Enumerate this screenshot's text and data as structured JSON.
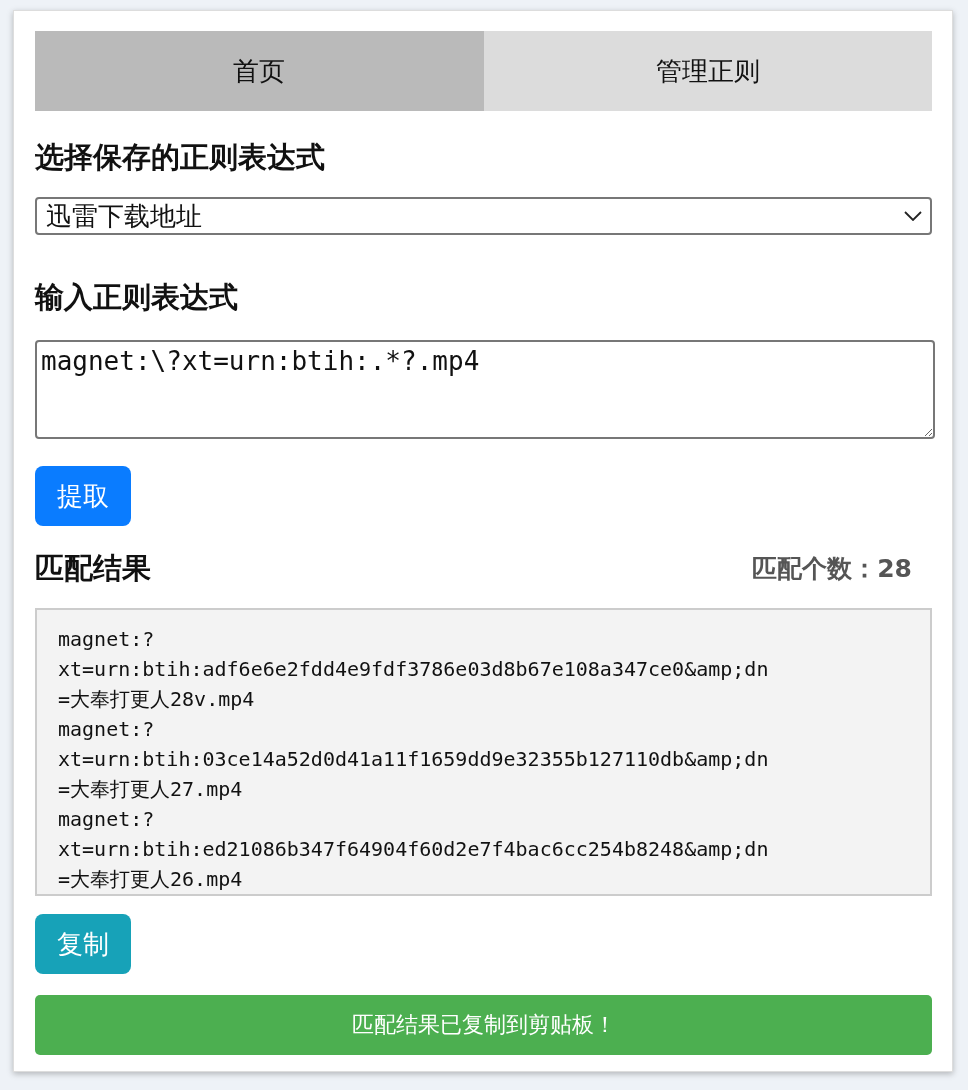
{
  "tabs": [
    {
      "label": "首页",
      "selected": true
    },
    {
      "label": "管理正则",
      "selected": false
    }
  ],
  "select_section": {
    "heading": "选择保存的正则表达式",
    "value": "迅雷下载地址"
  },
  "regex_section": {
    "heading": "输入正则表达式",
    "value": "magnet:\\?xt=urn:btih:.*?.mp4"
  },
  "extract_button": "提取",
  "results": {
    "heading": "匹配结果",
    "count": "匹配个数：28",
    "lines": [
      "magnet:?",
      "xt=urn:btih:adf6e6e2fdd4e9fdf3786e03d8b67e108a347ce0&amp;dn",
      "=大奉打更人28v.mp4",
      "magnet:?",
      "xt=urn:btih:03ce14a52d0d41a11f1659dd9e32355b127110db&amp;dn",
      "=大奉打更人27.mp4",
      "magnet:?",
      "xt=urn:btih:ed21086b347f64904f60d2e7f4bac6cc254b8248&amp;dn",
      "=大奉打更人26.mp4"
    ]
  },
  "copy_button": "复制",
  "notification": "匹配结果已复制到剪贴板！"
}
